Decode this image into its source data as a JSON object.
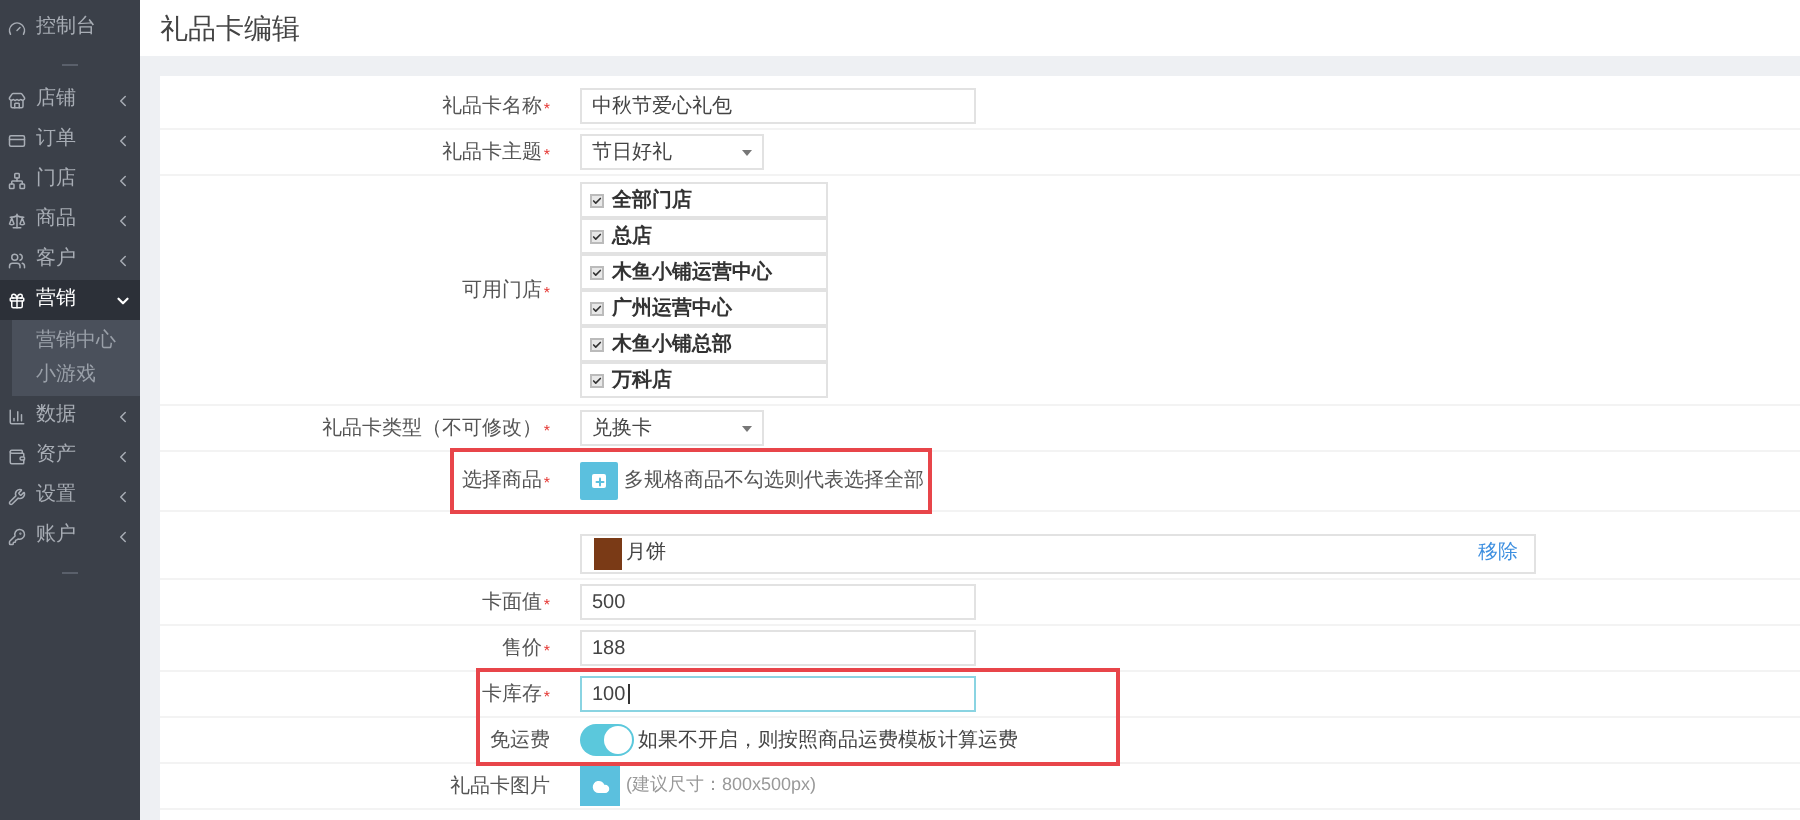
{
  "sidebar": {
    "items": [
      {
        "kind": "link",
        "label": "控制台",
        "expanded": false,
        "has_arrow": false
      },
      {
        "kind": "divider"
      },
      {
        "kind": "link",
        "label": "店铺",
        "expanded": false,
        "has_arrow": true
      },
      {
        "kind": "link",
        "label": "订单",
        "expanded": false,
        "has_arrow": true
      },
      {
        "kind": "link",
        "label": "门店",
        "expanded": false,
        "has_arrow": true
      },
      {
        "kind": "link",
        "label": "商品",
        "expanded": false,
        "has_arrow": true
      },
      {
        "kind": "link",
        "label": "客户",
        "expanded": false,
        "has_arrow": true
      },
      {
        "kind": "link",
        "label": "营销",
        "expanded": true,
        "has_arrow": true,
        "children": [
          {
            "label": "营销中心"
          },
          {
            "label": "小游戏"
          }
        ]
      },
      {
        "kind": "link",
        "label": "数据",
        "expanded": false,
        "has_arrow": true
      },
      {
        "kind": "link",
        "label": "资产",
        "expanded": false,
        "has_arrow": true
      },
      {
        "kind": "link",
        "label": "设置",
        "expanded": false,
        "has_arrow": true
      },
      {
        "kind": "link",
        "label": "账户",
        "expanded": false,
        "has_arrow": true
      },
      {
        "kind": "divider"
      }
    ]
  },
  "page_title": "礼品卡编辑",
  "form": {
    "groups": [
      {
        "highlighted": false,
        "rows": [
          {
            "kind": "text",
            "label": "礼品卡名称",
            "mark": "*",
            "value": "中秋节爱心礼包",
            "focused": false
          },
          {
            "kind": "select",
            "label": "礼品卡主题",
            "mark": "*",
            "value": "节日好礼"
          },
          {
            "kind": "checklist",
            "label": "可用门店",
            "mark": "*",
            "options": [
              {
                "label": "全部门店",
                "checked": true
              },
              {
                "label": "总店",
                "checked": true
              },
              {
                "label": "木鱼小铺运营中心",
                "checked": true
              },
              {
                "label": "广州运营中心",
                "checked": true
              },
              {
                "label": "木鱼小铺总部",
                "checked": true
              },
              {
                "label": "万科店",
                "checked": true
              }
            ]
          },
          {
            "kind": "select",
            "label": "礼品卡类型（不可修改）",
            "mark": "*",
            "value": "兑换卡"
          }
        ]
      },
      {
        "highlighted": true,
        "rows": [
          {
            "kind": "add",
            "label": "选择商品",
            "mark": "*",
            "hint": "多规格商品不勾选则代表选择全部"
          }
        ]
      },
      {
        "highlighted": false,
        "rows": [
          {
            "kind": "product",
            "label": "",
            "name": "月饼",
            "action": "移除"
          },
          {
            "kind": "text",
            "label": "卡面值",
            "mark": "*",
            "value": "500",
            "focused": false
          },
          {
            "kind": "text",
            "label": "售价",
            "mark": "*",
            "value": "188",
            "focused": false
          }
        ]
      },
      {
        "highlighted": true,
        "rows": [
          {
            "kind": "text",
            "label": "卡库存",
            "mark": "*",
            "value": "100",
            "focused": true
          },
          {
            "kind": "toggle",
            "label": "免运费",
            "on": true,
            "hint": "如果不开启，则按照商品运费模板计算运费"
          }
        ]
      },
      {
        "highlighted": false,
        "rows": [
          {
            "kind": "image",
            "label": "礼品卡图片",
            "hint": "(建议尺寸：800x500px)"
          }
        ]
      }
    ]
  }
}
